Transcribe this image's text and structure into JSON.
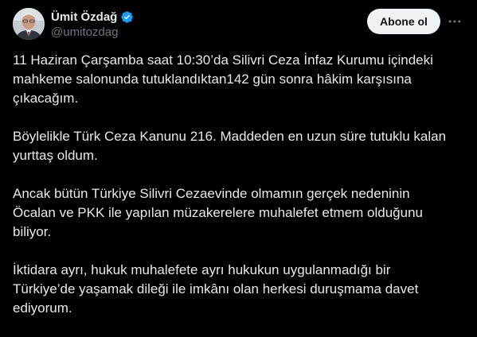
{
  "author": {
    "display_name": "Ümit Özdağ",
    "handle": "@umitozdag",
    "verified": true,
    "verified_color": "#1d9bf0"
  },
  "actions": {
    "follow_label": "Abone ol",
    "more_icon": "more-horizontal-icon"
  },
  "tweet": {
    "paragraphs": [
      "11 Haziran Çarşamba saat 10:30’da Silivri Ceza İnfaz Kurumu içindeki\nmahkeme salonunda tutuklandıktan142 gün sonra hâkim karşısına\nçıkacağım.",
      "Böylelikle Türk Ceza Kanunu 216. Maddeden en uzun süre tutuklu kalan\nyurttaş oldum.",
      "Ancak bütün Türkiye Silivri Cezaevinde olmamın gerçek nedeninin\nÖcalan ve PKK ile yapılan müzakerelere muhalefet etmem olduğunu\nbiliyor.",
      "İktidara ayrı, hukuk muhalefete ayrı hukukun uygulanmadığı bir\nTürkiye’de yaşamak dileği ile imkânı olan herkesi duruşmama davet\nediyorum."
    ]
  },
  "colors": {
    "background": "#000000",
    "text": "#e7e9ea",
    "secondary_text": "#71767b",
    "button_bg": "#eff3f4",
    "button_text": "#0f1419"
  }
}
